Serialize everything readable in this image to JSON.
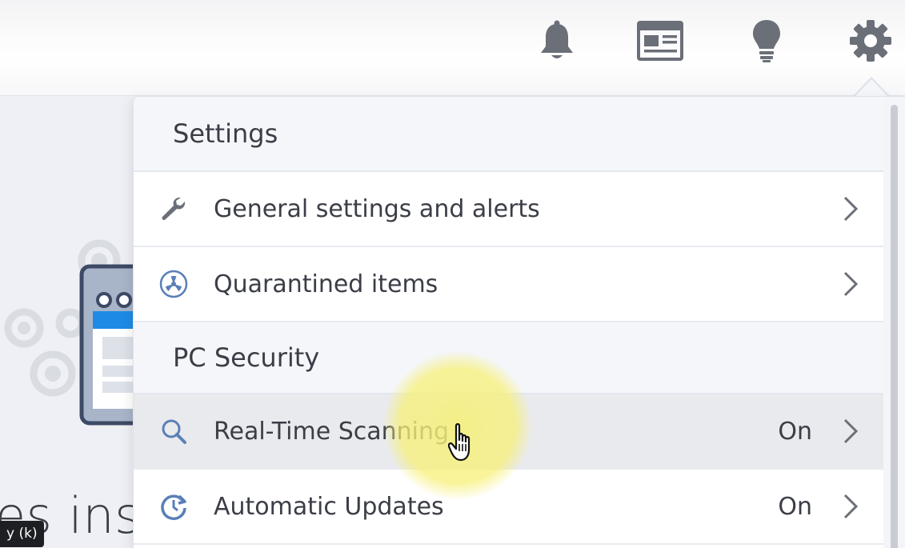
{
  "header": {
    "icons": [
      "bell-icon",
      "news-icon",
      "lightbulb-icon",
      "gear-icon"
    ]
  },
  "background": {
    "partial_text": "es inst",
    "hint_badge": "y (k)"
  },
  "menu": {
    "sections": [
      {
        "title": "Settings",
        "items": [
          {
            "label": "General settings and alerts",
            "icon": "wrench-icon",
            "status": ""
          },
          {
            "label": "Quarantined items",
            "icon": "radiation-icon",
            "status": ""
          }
        ]
      },
      {
        "title": "PC Security",
        "items": [
          {
            "label": "Real-Time Scanning",
            "icon": "search-icon",
            "status": "On"
          },
          {
            "label": "Automatic Updates",
            "icon": "update-icon",
            "status": "On"
          }
        ]
      }
    ]
  },
  "colors": {
    "text": "#3b3e47",
    "icon_grey": "#6b6f78",
    "row_hover": "#e9eaed",
    "section_bg": "#f4f6fa",
    "icon_blue": "#5a7fb8",
    "cursor_highlight": "#f7f078"
  }
}
